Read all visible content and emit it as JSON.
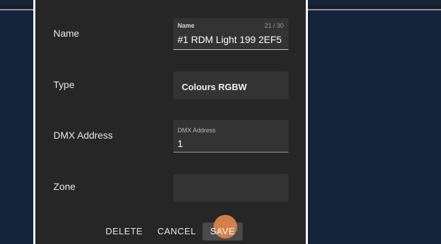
{
  "dialog": {
    "name_row": {
      "label": "Name",
      "field_label": "Name",
      "counter": "21 / 30",
      "value": "#1 RDM Light 199 2EF5"
    },
    "type_row": {
      "label": "Type",
      "value": "Colours RGBW"
    },
    "dmx_row": {
      "label": "DMX Address",
      "field_label": "DMX Address",
      "value": "1"
    },
    "zone_row": {
      "label": "Zone",
      "value": ""
    },
    "actions": {
      "delete": "DELETE",
      "cancel": "CANCEL",
      "save": "SAVE"
    }
  },
  "colors": {
    "dialog_bg": "#262626",
    "field_bg": "#333333",
    "backdrop": "#13233a",
    "ripple": "#e0844a"
  }
}
